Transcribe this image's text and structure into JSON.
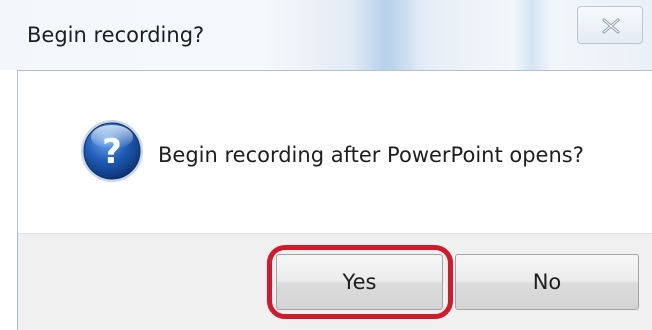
{
  "dialog": {
    "title": "Begin recording?",
    "message": "Begin recording after PowerPoint opens?",
    "icon": "question-icon"
  },
  "buttons": {
    "yes_label": "Yes",
    "no_label": "No",
    "close_icon": "close-icon"
  },
  "annotation": {
    "highlighted_button": "Yes",
    "color": "#d11a2a"
  },
  "colors": {
    "icon_blue": "#1f5bb5",
    "footer_bg": "#f0f0f0",
    "text": "#1e1e1e"
  }
}
